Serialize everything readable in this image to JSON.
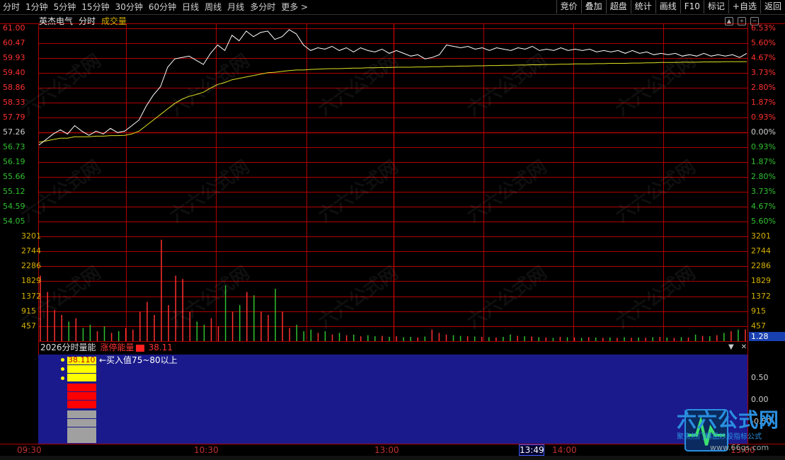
{
  "toolbar": {
    "left_items": [
      "分时",
      "1分钟",
      "5分钟",
      "15分钟",
      "30分钟",
      "60分钟",
      "日线",
      "周线",
      "月线",
      "多分时",
      "更多 >"
    ],
    "right_items": [
      "竞价",
      "叠加",
      "超盘",
      "统计",
      "画线",
      "F10",
      "标记",
      "+自选",
      "返回"
    ]
  },
  "header": {
    "stock_name": "英杰电气",
    "mode": "分时",
    "volume_label": "成交量"
  },
  "price_axis": {
    "left": [
      "61.00",
      "60.47",
      "59.93",
      "59.40",
      "58.86",
      "58.33",
      "57.79",
      "57.26",
      "56.73",
      "56.19",
      "55.66",
      "55.12",
      "54.59",
      "54.05"
    ],
    "right": [
      "6.53%",
      "5.60%",
      "4.67%",
      "3.73%",
      "2.80%",
      "1.87%",
      "0.93%",
      "0.00%",
      "0.93%",
      "1.87%",
      "2.80%",
      "3.73%",
      "4.67%",
      "5.60%"
    ]
  },
  "volume_axis": {
    "left": [
      "3201",
      "2744",
      "2286",
      "1829",
      "1372",
      "915",
      "457"
    ],
    "right": [
      "3201",
      "2744",
      "2286",
      "1829",
      "1372",
      "915",
      "457"
    ],
    "current_tag": "1.28"
  },
  "indicator": {
    "name": "2026分时量能",
    "sub_label": "涨停能量",
    "value": "38.11",
    "stack_value": "38.110",
    "note": "←买入值75~80以上",
    "right_axis": [
      "0.50",
      "0.00",
      "-0.50"
    ]
  },
  "time_axis": {
    "labels": [
      "09:30",
      "10:30",
      "13:00",
      "14:00",
      "15:00"
    ],
    "current": "13:49"
  },
  "logo": {
    "title": "六六公式网",
    "subtitle": "聚焦热门精品炒股指标公式",
    "url": "www.66gs.com"
  },
  "colors": {
    "grid": "#b00000",
    "price_line": "#ffffff",
    "avg_line": "#e0e020",
    "up": "#ff3030",
    "down": "#30c030",
    "panel": "#1a1a8c"
  },
  "chart_data": {
    "type": "line",
    "title": "",
    "prev_close": 57.26,
    "ylim": [
      54.05,
      61.0
    ],
    "series": [
      {
        "name": "",
        "values": [
          56.8,
          57.0,
          57.2,
          57.35,
          57.2,
          57.5,
          57.3,
          57.15,
          57.3,
          57.2,
          57.4,
          57.25,
          57.3,
          57.5,
          57.7,
          58.2,
          58.6,
          58.9,
          59.6,
          59.9,
          59.95,
          60.0,
          59.85,
          59.7,
          60.1,
          60.4,
          60.2,
          60.75,
          60.55,
          60.9,
          60.7,
          60.85,
          60.9,
          60.6,
          60.7,
          60.95,
          60.8,
          60.4,
          60.2,
          60.3,
          60.25,
          60.35,
          60.2,
          60.3,
          60.15,
          60.3,
          60.2,
          60.15,
          60.25,
          60.1,
          60.2,
          60.1,
          60.0,
          60.05,
          59.9,
          59.95,
          60.05,
          60.4,
          60.35,
          60.3,
          60.35,
          60.25,
          60.3,
          60.2,
          60.3,
          60.25,
          60.2,
          60.3,
          60.25,
          60.35,
          60.2,
          60.25,
          60.2,
          60.3,
          60.2,
          60.25,
          60.2,
          60.25,
          60.15,
          60.2,
          60.15,
          60.2,
          60.1,
          60.2,
          60.1,
          60.15,
          60.05,
          60.1,
          60.05,
          60.1,
          60.0,
          60.05,
          60.0,
          60.1,
          60.0,
          60.05,
          60.0,
          60.05,
          59.95,
          60.1
        ]
      },
      {
        "name": "",
        "values": [
          56.9,
          56.95,
          57.0,
          57.05,
          57.05,
          57.1,
          57.1,
          57.1,
          57.12,
          57.12,
          57.14,
          57.14,
          57.15,
          57.2,
          57.3,
          57.5,
          57.7,
          57.9,
          58.1,
          58.3,
          58.45,
          58.55,
          58.62,
          58.7,
          58.85,
          58.98,
          59.05,
          59.15,
          59.2,
          59.25,
          59.3,
          59.35,
          59.4,
          59.42,
          59.45,
          59.48,
          59.5,
          59.5,
          59.52,
          59.53,
          59.54,
          59.55,
          59.55,
          59.56,
          59.57,
          59.57,
          59.58,
          59.58,
          59.59,
          59.59,
          59.6,
          59.6,
          59.6,
          59.61,
          59.61,
          59.62,
          59.62,
          59.63,
          59.63,
          59.64,
          59.64,
          59.65,
          59.65,
          59.66,
          59.66,
          59.67,
          59.67,
          59.68,
          59.68,
          59.69,
          59.69,
          59.7,
          59.7,
          59.71,
          59.71,
          59.72,
          59.72,
          59.72,
          59.73,
          59.73,
          59.74,
          59.74,
          59.74,
          59.75,
          59.75,
          59.76,
          59.76,
          59.77,
          59.77,
          59.77,
          59.78,
          59.78,
          59.78,
          59.79,
          59.79,
          59.79,
          59.8,
          59.8,
          59.8,
          59.8
        ]
      }
    ],
    "volume": {
      "ylim": [
        0,
        3201
      ],
      "values": [
        2000,
        1500,
        950,
        800,
        600,
        700,
        400,
        500,
        300,
        450,
        250,
        300,
        400,
        350,
        900,
        1200,
        800,
        3100,
        1100,
        2000,
        1900,
        900,
        600,
        500,
        700,
        450,
        1700,
        900,
        1100,
        1500,
        1400,
        900,
        800,
        1600,
        900,
        400,
        500,
        300,
        350,
        250,
        300,
        200,
        250,
        180,
        200,
        150,
        180,
        150,
        160,
        130,
        150,
        120,
        130,
        110,
        140,
        350,
        250,
        200,
        180,
        160,
        150,
        140,
        130,
        120,
        110,
        130,
        200,
        160,
        150,
        140,
        120,
        110,
        100,
        130,
        120,
        110,
        100,
        120,
        110,
        100,
        110,
        100,
        120,
        100,
        110,
        100,
        120,
        130,
        110,
        100,
        120,
        110,
        200,
        160,
        150,
        180,
        250,
        300,
        350,
        360
      ]
    }
  }
}
